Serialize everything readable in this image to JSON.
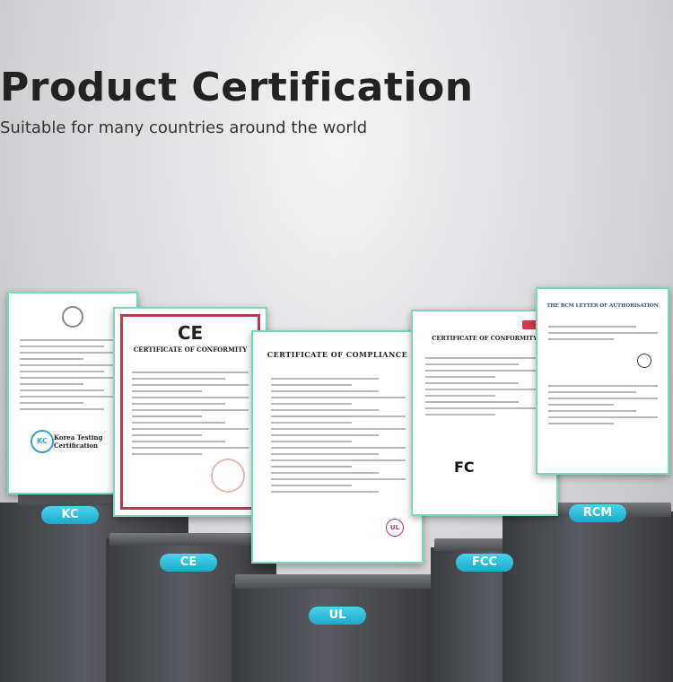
{
  "header": {
    "title": "Product Certification",
    "subtitle": "Suitable for many countries around the world"
  },
  "certificates": {
    "kc": {
      "label": "KC",
      "heading": "Korea Testing Certification",
      "stamp": "KC"
    },
    "ce": {
      "label": "CE",
      "heading": "CERTIFICATE OF CONFORMITY",
      "mark": "CE"
    },
    "ul": {
      "label": "UL",
      "heading": "CERTIFICATE OF COMPLIANCE",
      "mark": "UL"
    },
    "fcc": {
      "label": "FCC",
      "heading": "CERTIFICATE OF CONFORMITY",
      "mark": "FC"
    },
    "rcm": {
      "label": "RCM",
      "heading": "THE RCM LETTER OF AUTHORISATION"
    }
  },
  "colors": {
    "label_bg": "#1aa9cc",
    "cert_border": "#7ed8b6",
    "podium": "#45464a"
  }
}
